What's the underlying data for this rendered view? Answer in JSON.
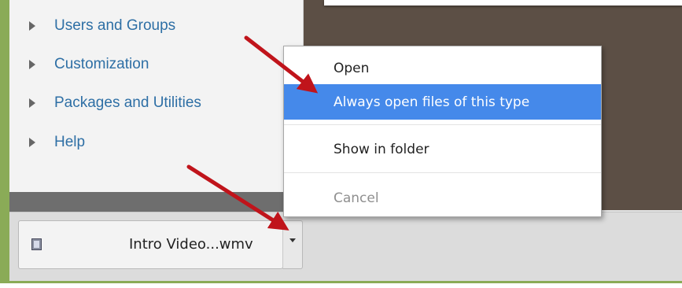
{
  "sidebar": {
    "items": [
      {
        "label": "Users and Groups"
      },
      {
        "label": "Customization"
      },
      {
        "label": "Packages and Utilities"
      },
      {
        "label": "Help"
      }
    ]
  },
  "download_bar": {
    "item": {
      "file_name": "Intro Video...wmv",
      "icon": "video-file-icon"
    },
    "dropdown_icon": "chevron-down-icon"
  },
  "context_menu": {
    "items": [
      {
        "label": "Open",
        "state": "normal"
      },
      {
        "label": "Always open files of this type",
        "state": "highlighted"
      },
      {
        "label": "Show in folder",
        "state": "normal"
      },
      {
        "label": "Cancel",
        "state": "disabled"
      }
    ]
  },
  "annotations": {
    "arrow_color": "#c0141b"
  },
  "colors": {
    "accent_highlight": "#4589ea",
    "link": "#2e6fa5",
    "frame": "#8aab57"
  }
}
